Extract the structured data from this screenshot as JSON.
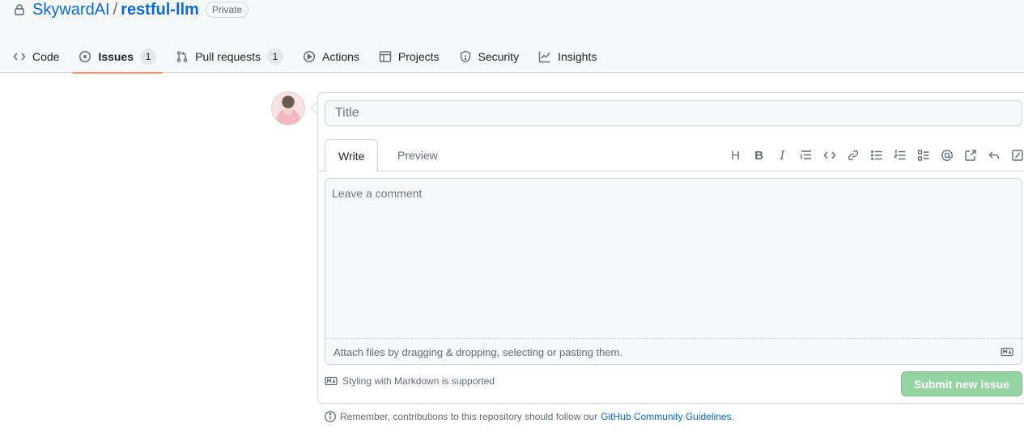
{
  "repo": {
    "owner": "SkywardAI",
    "separator": "/",
    "name": "restful-llm",
    "visibility": "Private"
  },
  "tabs": [
    {
      "label": "Code",
      "icon": "code-icon"
    },
    {
      "label": "Issues",
      "icon": "issue-opened-icon",
      "count": "1",
      "active": true
    },
    {
      "label": "Pull requests",
      "icon": "git-pull-request-icon",
      "count": "1"
    },
    {
      "label": "Actions",
      "icon": "play-icon"
    },
    {
      "label": "Projects",
      "icon": "table-icon"
    },
    {
      "label": "Security",
      "icon": "shield-icon"
    },
    {
      "label": "Insights",
      "icon": "graph-icon"
    }
  ],
  "issue_form": {
    "title_placeholder": "Title",
    "write_tab": "Write",
    "preview_tab": "Preview",
    "toolbar": [
      "heading-icon",
      "bold-icon",
      "italic-icon",
      "quote-icon",
      "code-icon",
      "link-icon",
      "unordered-list-icon",
      "ordered-list-icon",
      "task-list-icon",
      "mention-icon",
      "cross-reference-icon",
      "saved-reply-icon",
      "slash-command-icon"
    ],
    "comment_placeholder": "Leave a comment",
    "attach_text": "Attach files by dragging & dropping, selecting or pasting them.",
    "markdown_note": "Styling with Markdown is supported",
    "submit_label": "Submit new issue"
  },
  "reminder": {
    "text": "Remember, contributions to this repository should follow our",
    "link_text": "GitHub Community Guidelines",
    "suffix": "."
  },
  "colors": {
    "link": "#0969da",
    "active_tab_underline": "#fd8c73",
    "submit_disabled": "#94d3a2"
  }
}
